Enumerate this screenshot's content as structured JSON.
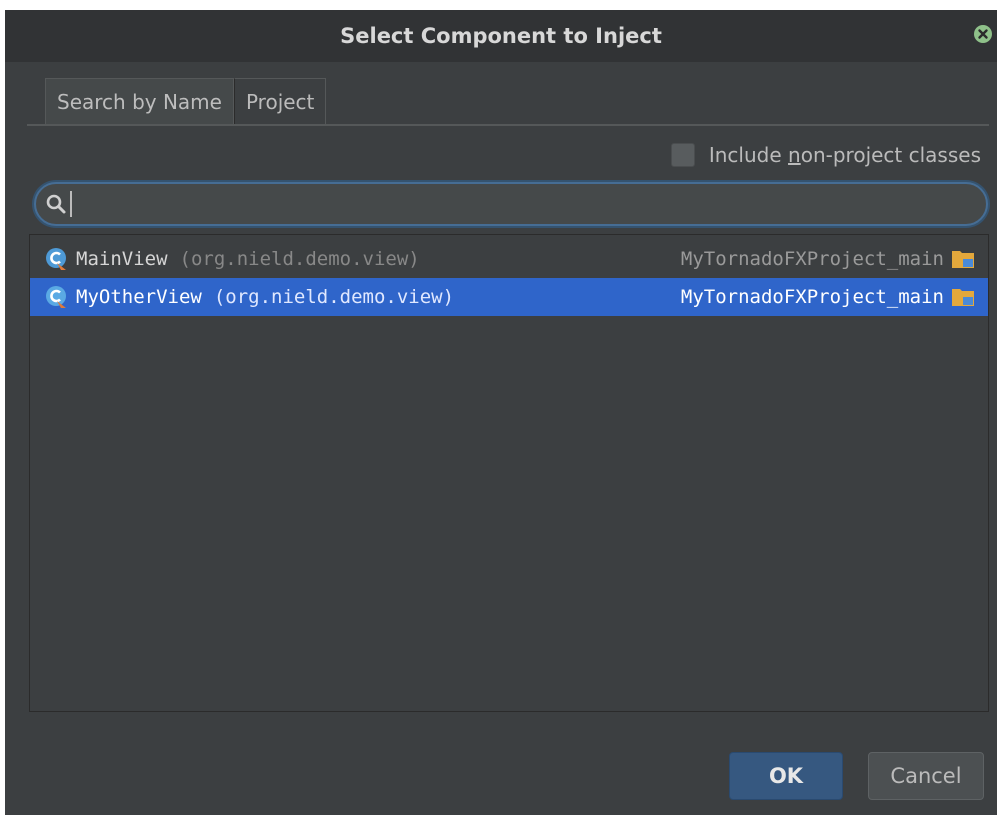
{
  "dialog": {
    "title": "Select Component to Inject",
    "close_icon": "close-circle-icon"
  },
  "tabs": [
    {
      "label": "Search by Name",
      "active": true
    },
    {
      "label": "Project",
      "active": false
    }
  ],
  "options": {
    "include_label_pre": "Include ",
    "include_label_mnemonic": "n",
    "include_label_post": "on-project classes",
    "include_checked": false
  },
  "search": {
    "value": "",
    "placeholder": "",
    "icon": "search-icon"
  },
  "results": [
    {
      "name": "MainView",
      "package": "(org.nield.demo.view)",
      "module": "MyTornadoFXProject_main",
      "selected": false,
      "icon": "class-icon"
    },
    {
      "name": "MyOtherView",
      "package": "(org.nield.demo.view)",
      "module": "MyTornadoFXProject_main",
      "selected": true,
      "icon": "class-icon"
    }
  ],
  "buttons": {
    "ok": "OK",
    "cancel": "Cancel"
  },
  "colors": {
    "background": "#3c3f41",
    "titlebar": "#313335",
    "selection": "#2f65ca",
    "ok_button": "#365880",
    "focus_ring": "#466d94"
  }
}
